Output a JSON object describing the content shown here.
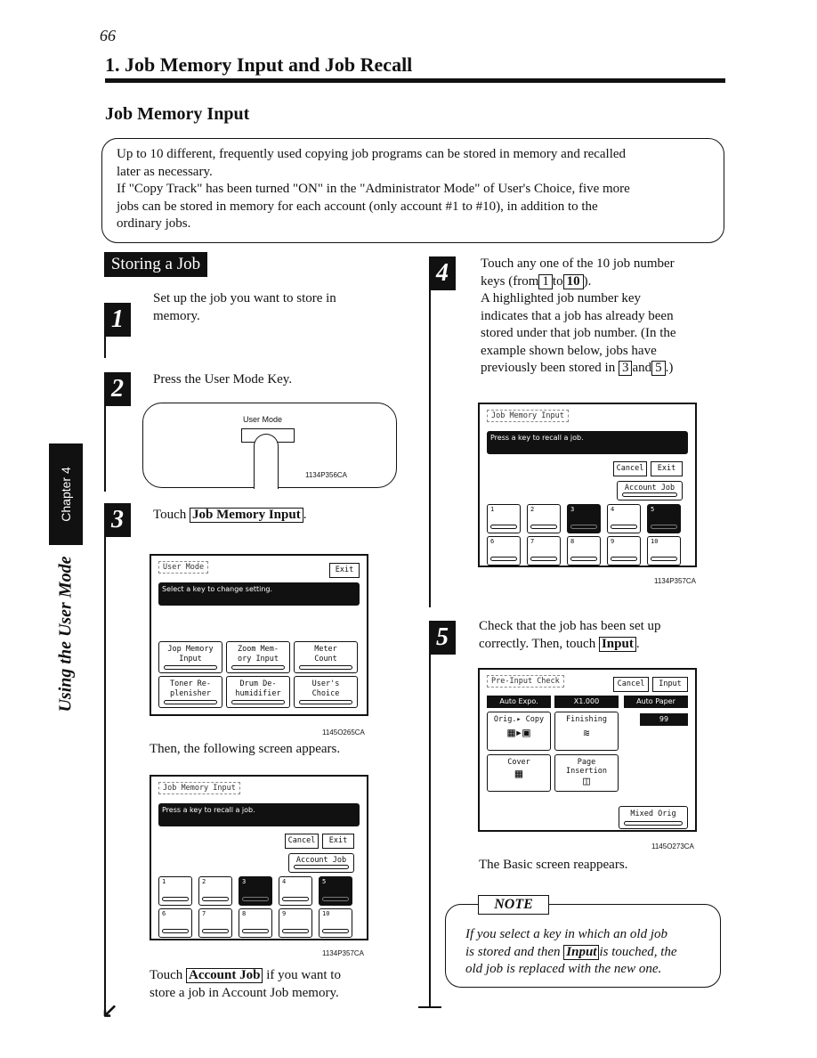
{
  "page_number": "66",
  "section_title": "1. Job Memory Input and Job Recall",
  "subtitle": "Job Memory Input",
  "intro": [
    "Up to 10 different, frequently used copying job programs can be stored in memory and recalled",
    "later as necessary.",
    "If \"Copy Track\" has been turned \"ON\" in the \"Administrator Mode\" of User's Choice, five more",
    "jobs can be stored in memory for each account (only account #1 to #10), in addition to the",
    "ordinary jobs."
  ],
  "side_tab": {
    "chapter": "Chapter 4",
    "title": "Using the User Mode"
  },
  "storing_heading": "Storing a Job",
  "steps": {
    "s1": {
      "num": "1",
      "text": [
        "Set up the job you want to store in",
        "memory."
      ]
    },
    "s2": {
      "num": "2",
      "text": "Press the User Mode Key.",
      "key_label": "User Mode",
      "caption": "1134P356CA"
    },
    "s3": {
      "num": "3",
      "pre": "Touch",
      "key": "Job Memory Input",
      "post": ".",
      "caption1": "1145O265CA",
      "then": "Then, the following screen appears.",
      "caption2": "1134P357CA",
      "touch": "Touch",
      "account_key": "Account Job",
      "after": [
        "if you want to",
        "store a job in Account Job memory."
      ]
    },
    "s4": {
      "num": "4",
      "l1": "Touch any one of the 10 job number",
      "l2a": "keys (from",
      "k1": "1",
      "l2b": "to",
      "k2": "10",
      "l2c": ").",
      "l3": "A highlighted job number key",
      "l4": "indicates that a job has already been",
      "l5": "stored under that job number. (In the",
      "l6": "example shown below, jobs have",
      "l7a": "previously been stored in",
      "k3": "3",
      "l7b": "and",
      "k4": "5",
      "l7c": ".)",
      "caption": "1134P357CA"
    },
    "s5": {
      "num": "5",
      "l1": "Check that the job has been set up",
      "l2a": "correctly. Then, touch",
      "key": "Input",
      "l2b": ".",
      "caption": "1145O273CA",
      "after": "The Basic screen reappears."
    }
  },
  "user_mode_screen": {
    "title": "User Mode",
    "exit": "Exit",
    "message": "Select a key to change setting.",
    "keys": [
      "Jop Memory\nInput",
      "Zoom Mem-\nory Input",
      "Meter\nCount",
      "Toner Re-\nplenisher",
      "Drum De-\nhumidifier",
      "User's\nChoice"
    ]
  },
  "job_screen": {
    "title": "Job Memory Input",
    "message": "Press a key to recall a job.",
    "cancel": "Cancel",
    "exit": "Exit",
    "account": "Account Job",
    "keys": [
      "1",
      "2",
      "3",
      "4",
      "5",
      "6",
      "7",
      "8",
      "9",
      "10"
    ],
    "highlighted": [
      "3",
      "5"
    ]
  },
  "preinput_screen": {
    "title": "Pre-Input Check",
    "cancel": "Cancel",
    "input": "Input",
    "expo": "Auto Expo.",
    "zoom": "X1.000",
    "paper": "Auto Paper",
    "count": "99",
    "orig_copy": "Orig.▸ Copy",
    "finishing": "Finishing",
    "cover": "Cover",
    "page_insertion": "Page\nInsertion",
    "mixed": "Mixed Orig"
  },
  "note": {
    "label": "NOTE",
    "l1": "If you select a key in which an old job",
    "l2a": "is stored and then",
    "key": "Input",
    "l2b": "is touched, the",
    "l3": "old job is replaced with the new one."
  }
}
